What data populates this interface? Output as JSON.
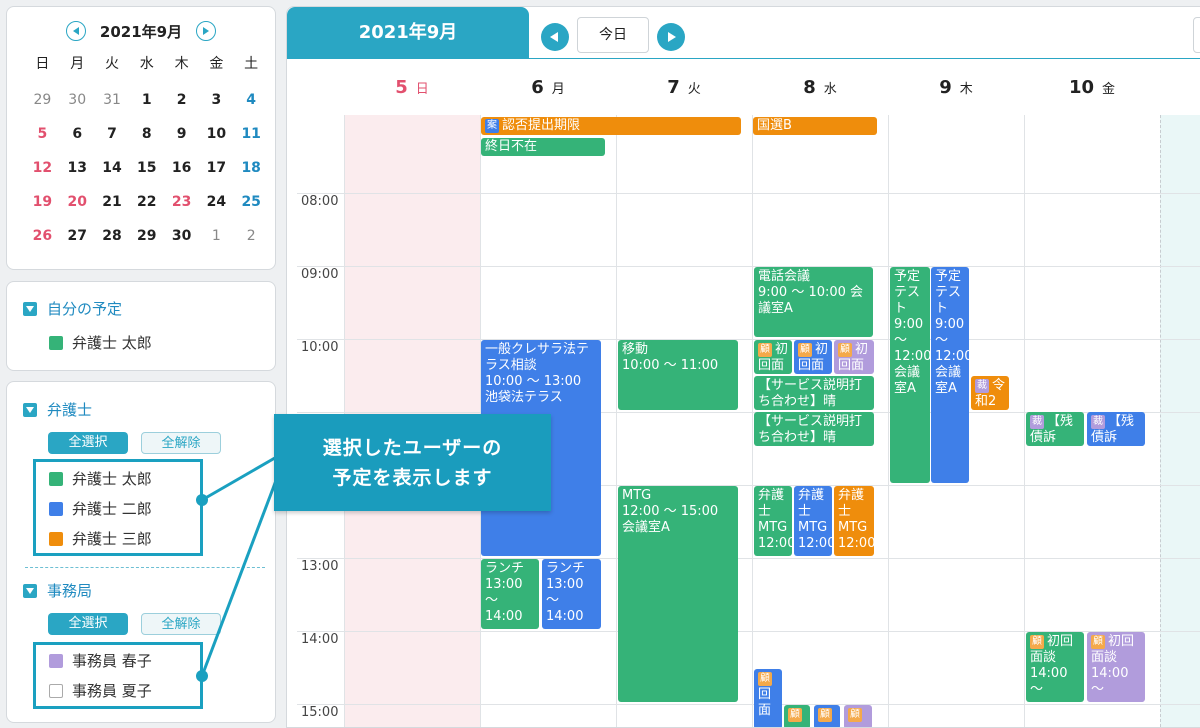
{
  "mini_calendar": {
    "title": "2021年9月",
    "weekdays": [
      "日",
      "月",
      "火",
      "水",
      "木",
      "金",
      "土"
    ],
    "weeks": [
      [
        "29",
        "30",
        "31",
        "1",
        "2",
        "3",
        "4"
      ],
      [
        "5",
        "6",
        "7",
        "8",
        "9",
        "10",
        "11"
      ],
      [
        "12",
        "13",
        "14",
        "15",
        "16",
        "17",
        "18"
      ],
      [
        "19",
        "20",
        "21",
        "22",
        "23",
        "24",
        "25"
      ],
      [
        "26",
        "27",
        "28",
        "29",
        "30",
        "1",
        "2"
      ]
    ]
  },
  "my_schedule": {
    "title": "自分の予定",
    "member": "弁護士 太郎"
  },
  "lawyers": {
    "title": "弁護士",
    "select_all": "全選択",
    "deselect_all": "全解除",
    "members": [
      "弁護士 太郎",
      "弁護士 二郎",
      "弁護士 三郎"
    ]
  },
  "office": {
    "title": "事務局",
    "select_all": "全選択",
    "deselect_all": "全解除",
    "members": [
      "事務員 春子",
      "事務員 夏子"
    ]
  },
  "callout": {
    "line1": "選択したユーザーの",
    "line2": "予定を表示します"
  },
  "header": {
    "month": "2021年9月",
    "today": "今日"
  },
  "days": [
    {
      "num": "5",
      "wd": "日"
    },
    {
      "num": "6",
      "wd": "月"
    },
    {
      "num": "7",
      "wd": "火"
    },
    {
      "num": "8",
      "wd": "水"
    },
    {
      "num": "9",
      "wd": "木"
    },
    {
      "num": "10",
      "wd": "金"
    }
  ],
  "times": [
    "08:00",
    "09:00",
    "10:00",
    "13:00",
    "14:00",
    "15:00"
  ],
  "events": {
    "e1": "認否提出期限",
    "e2": "終日不在",
    "e3": "国選B",
    "e4": "電話会議\n9:00 ～ 10:00 会議室A",
    "e5": "予定テスト\n9:00\n～\n12:00\n会議室A",
    "e6": "予定テスト\n9:00\n～\n12:00\n会議室A",
    "e7": "一般クレサラ法テラス相談\n10:00 ～ 13:00\n池袋法テラス",
    "e8": "移動\n10:00 ～ 11:00",
    "e9": "初回面",
    "e10": "初回面",
    "e11": "初回面",
    "e12": "【サービス説明打ち合わせ】晴",
    "e13": "【サービス説明打ち合わせ】晴",
    "e14": "令和2",
    "e15": "【残債訴",
    "e16": "【残債訴",
    "e17": "MTG\n12:00 ～ 15:00\n会議室A",
    "e18": "弁護士\nMTG\n12:00",
    "e19": "弁護士\nMTG\n12:00",
    "e20": "弁護士\nMTG\n12:00",
    "e21": "ランチ\n13:00\n～\n14:00",
    "e22": "ランチ\n13:00\n～\n14:00",
    "e23": "初回面談\n14:00\n～",
    "e24": "初回面談\n14:00\n～",
    "e25": "回面"
  },
  "tags": {
    "case": "案",
    "consult": "顧",
    "admin": "裁"
  },
  "colors": {
    "accent": "#2aa6c4",
    "green": "#35b378",
    "blue": "#3f7fe8",
    "orange": "#ef8d0c",
    "purple": "#b19cdc",
    "sunday": "#e2506e",
    "saturday": "#1f8ac0"
  }
}
